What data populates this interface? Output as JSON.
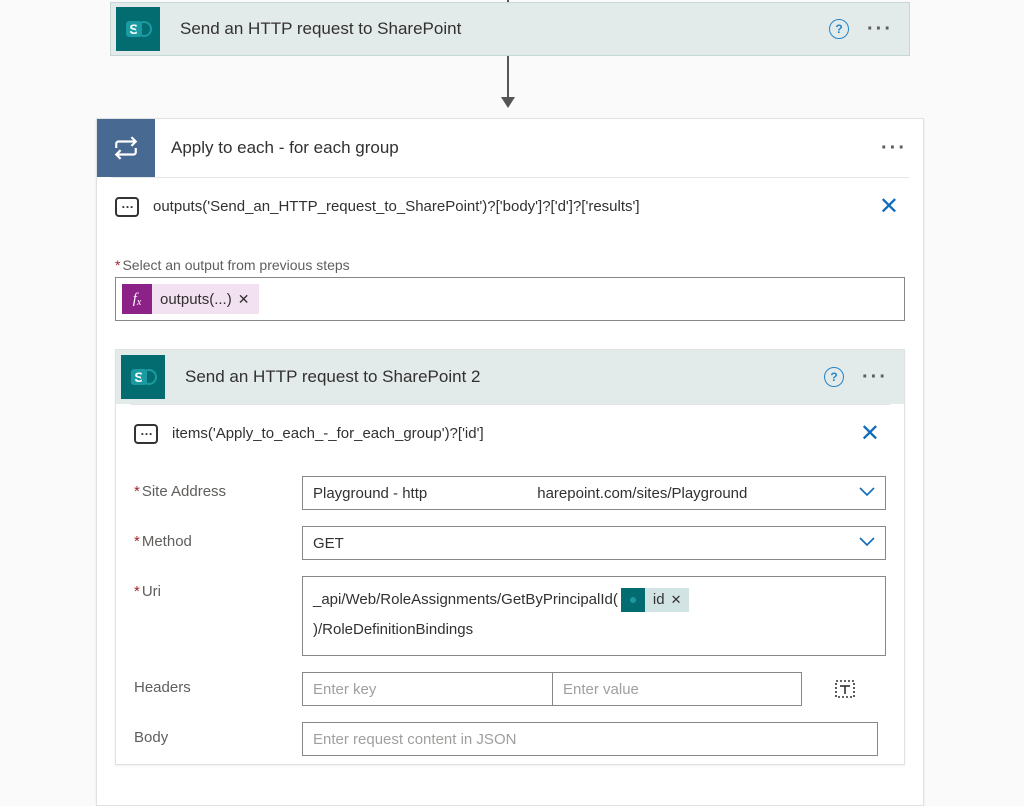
{
  "http1": {
    "title": "Send an HTTP request to SharePoint"
  },
  "apply_to_each": {
    "title": "Apply to each - for each group",
    "peek": "outputs('Send_an_HTTP_request_to_SharePoint')?['body']?['d']?['results']",
    "select_label": "Select an output from previous steps",
    "pill_text": "outputs(...)"
  },
  "http2": {
    "title": "Send an HTTP request to SharePoint 2",
    "peek": "items('Apply_to_each_-_for_each_group')?['id']",
    "labels": {
      "site": "Site Address",
      "method": "Method",
      "uri": "Uri",
      "headers": "Headers",
      "body": "Body"
    },
    "site_value_left": "Playground - http",
    "site_value_right": "harepoint.com/sites/Playground",
    "method_value": "GET",
    "uri_prefix": "_api/Web/RoleAssignments/GetByPrincipalId(",
    "uri_token": "id",
    "uri_suffix": ")/RoleDefinitionBindings",
    "headers_key_ph": "Enter key",
    "headers_val_ph": "Enter value",
    "body_ph": "Enter request content in JSON"
  }
}
